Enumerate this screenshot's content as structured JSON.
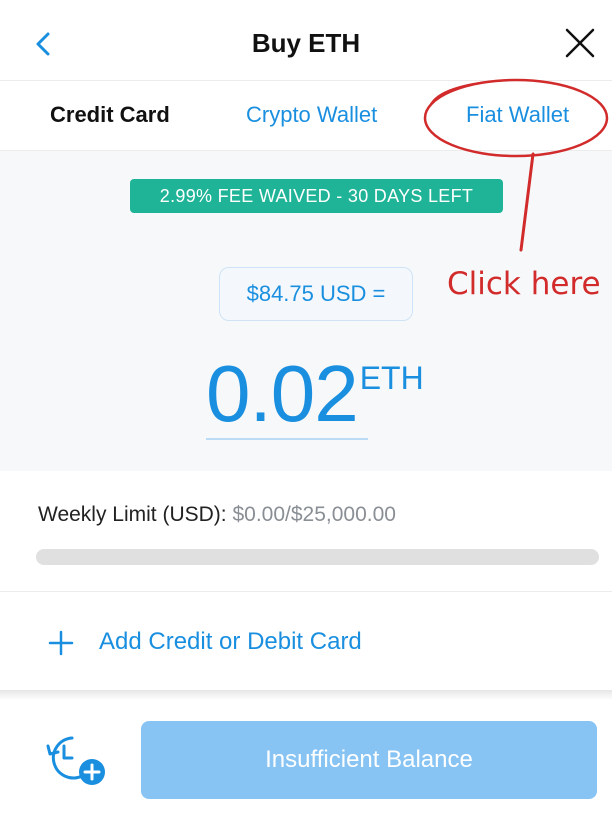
{
  "header": {
    "title": "Buy ETH",
    "back_icon": "chevron-left-icon",
    "close_icon": "close-icon"
  },
  "tabs": [
    {
      "label": "Credit Card",
      "active": true
    },
    {
      "label": "Crypto Wallet",
      "active": false
    },
    {
      "label": "Fiat Wallet",
      "active": false
    }
  ],
  "promo": {
    "fee_badge": "2.99% FEE WAIVED - 30 DAYS LEFT"
  },
  "amount": {
    "fiat_label": "$84.75 USD =",
    "crypto_value": "0.02",
    "crypto_unit": "ETH"
  },
  "limit": {
    "label": "Weekly Limit (USD):",
    "value": "$0.00/$25,000.00",
    "progress_fraction": 0
  },
  "add_card": {
    "label": "Add Credit or Debit Card"
  },
  "footer": {
    "history_icon": "clock-add-icon",
    "submit_label": "Insufficient Balance"
  },
  "annotation": {
    "text": "Click here"
  },
  "colors": {
    "accent": "#1a8fe0",
    "badge": "#1fb497",
    "button_disabled": "#87c4f4",
    "annotation": "#d22b2b"
  }
}
